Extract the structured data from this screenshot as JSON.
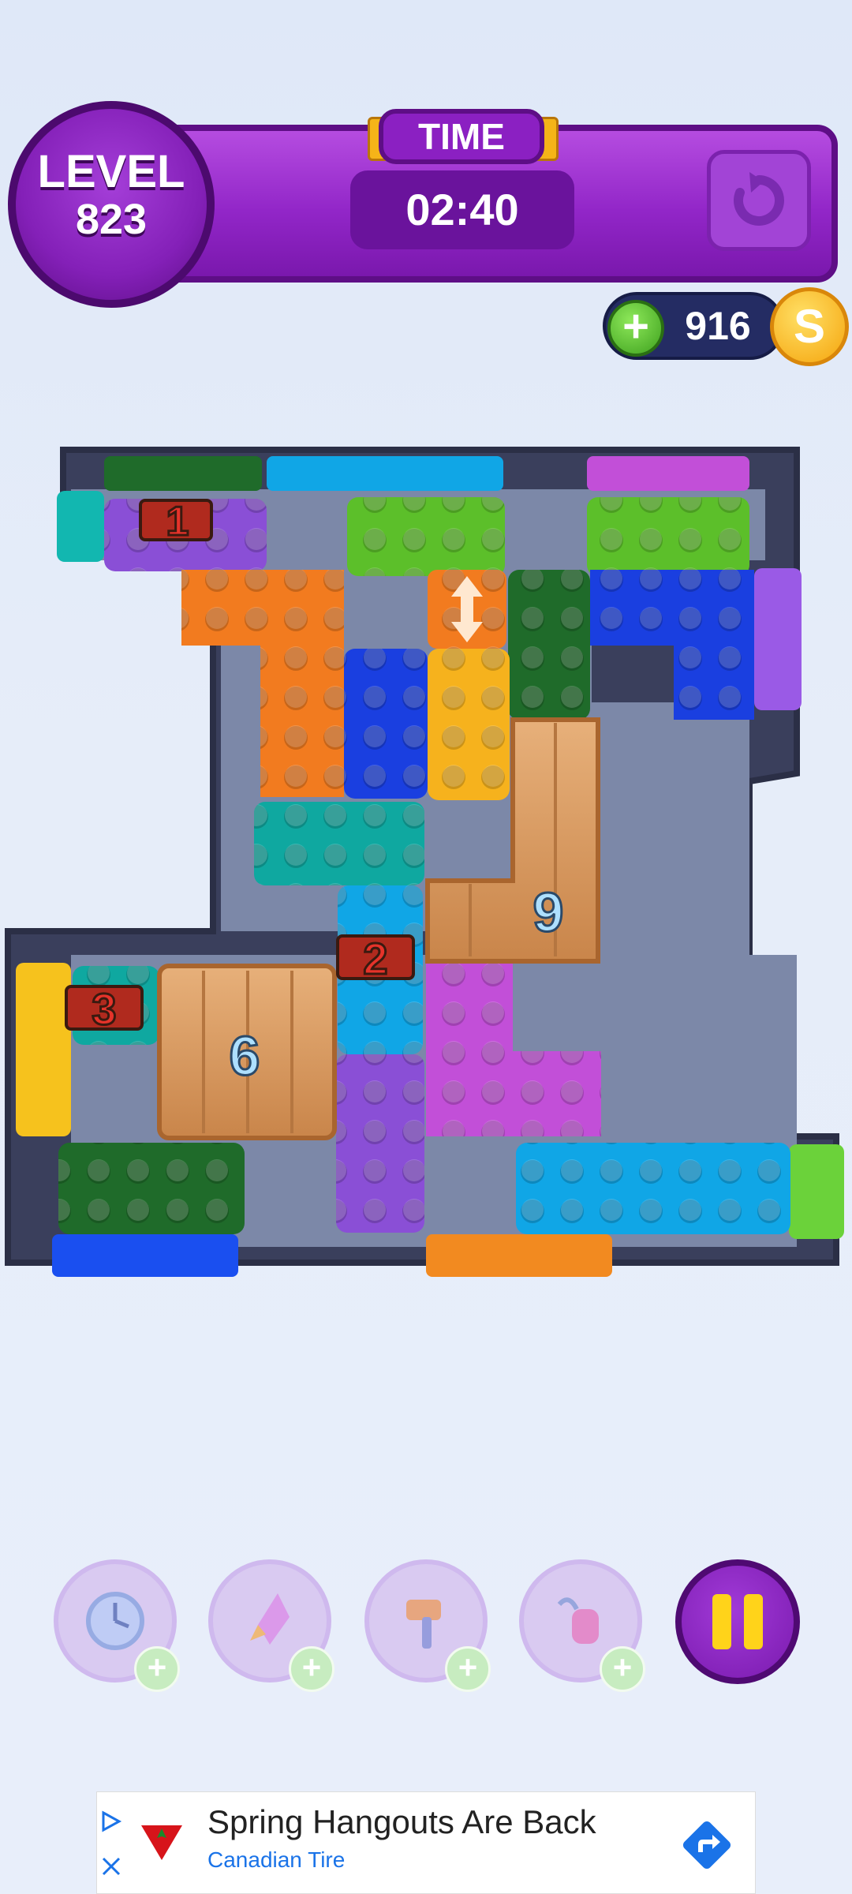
{
  "header": {
    "level_label": "LEVEL",
    "level_number": "823",
    "time_label": "TIME",
    "timer": "02:40",
    "retry_icon": "retry-icon"
  },
  "wallet": {
    "coins": "916",
    "add_icon": "plus-icon",
    "coin_icon": "coin-icon",
    "coin_symbol": "S"
  },
  "board": {
    "block_colors": {
      "purple": "#8a4fd6",
      "dark_green": "#1f6b2a",
      "green": "#5cbf2a",
      "blue": "#1a3fe0",
      "cyan": "#10a6e6",
      "teal": "#0fa8a0",
      "orange": "#f27b1f",
      "yellow": "#f6b21d",
      "magenta": "#c24fd8",
      "wood": "#d99a5b"
    },
    "locks": [
      {
        "label": "1",
        "icon": "chain-lock-icon"
      },
      {
        "label": "2",
        "icon": "chain-lock-icon"
      },
      {
        "label": "3",
        "icon": "chain-lock-icon"
      }
    ],
    "wood_blocks": [
      {
        "label": "9"
      },
      {
        "label": "6"
      }
    ]
  },
  "boosters": [
    {
      "name": "freeze-booster",
      "icon": "clock-freeze-icon",
      "plus": "+"
    },
    {
      "name": "rocket-booster",
      "icon": "rocket-icon",
      "plus": "+"
    },
    {
      "name": "hammer-booster",
      "icon": "hammer-icon",
      "plus": "+"
    },
    {
      "name": "vacuum-booster",
      "icon": "vacuum-icon",
      "plus": "+"
    }
  ],
  "pause_icon": "pause-icon",
  "ad": {
    "title": "Spring Hangouts Are Back",
    "advertiser": "Canadian Tire",
    "arrow_icon": "directions-icon",
    "close_icon": "close-icon",
    "adchoices_icon": "adchoices-icon"
  }
}
